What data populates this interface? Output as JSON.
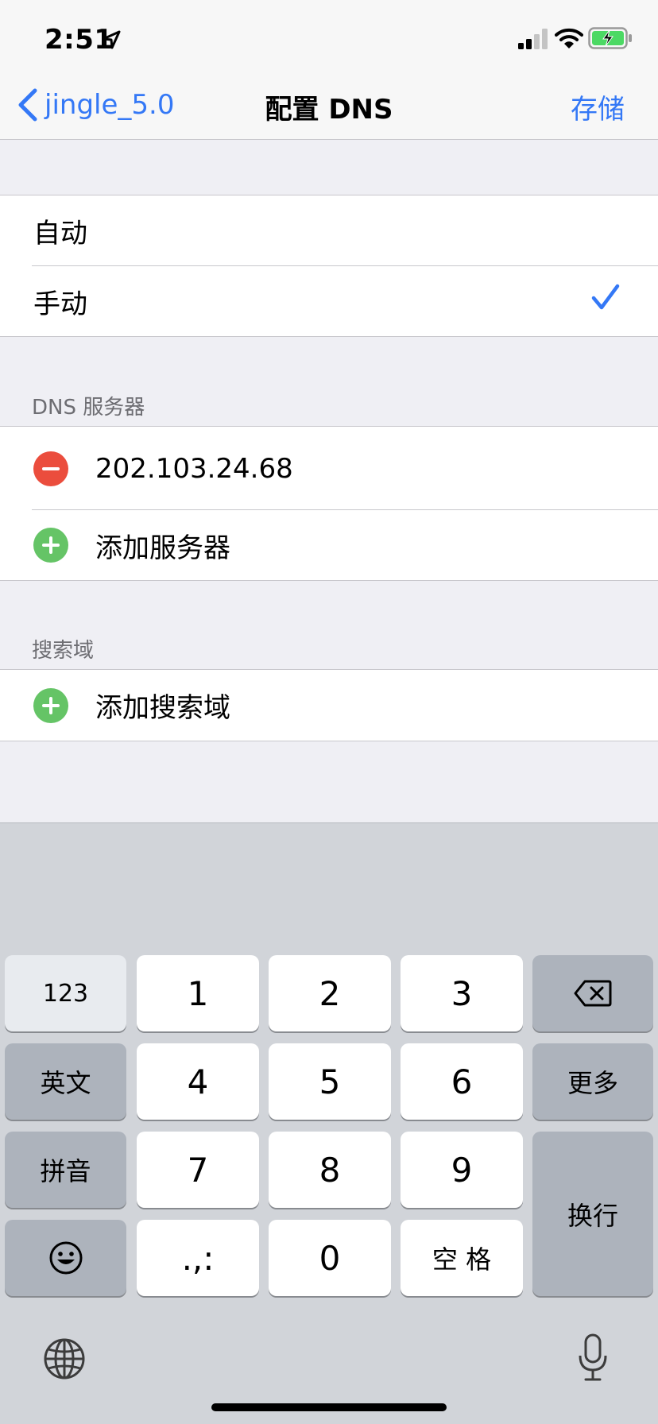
{
  "status_bar": {
    "time": "2:51"
  },
  "nav": {
    "back_label": "jingle_5.0",
    "title": "配置 DNS",
    "save_label": "存储"
  },
  "configure": {
    "items": [
      {
        "label": "自动",
        "selected": false
      },
      {
        "label": "手动",
        "selected": true
      }
    ]
  },
  "dns_servers": {
    "header": "DNS 服务器",
    "servers": [
      "202.103.24.68"
    ],
    "add_label": "添加服务器"
  },
  "search_domains": {
    "header": "搜索域",
    "add_label": "添加搜索域"
  },
  "keyboard": {
    "rows": [
      [
        "123",
        "1",
        "2",
        "3",
        "delete-icon"
      ],
      [
        "英文",
        "4",
        "5",
        "6",
        "更多"
      ],
      [
        "拼音",
        "7",
        "8",
        "9",
        "换行"
      ],
      [
        "emoji-icon",
        ".,:",
        "0",
        "空格"
      ]
    ],
    "key_123": "123",
    "key_1": "1",
    "key_2": "2",
    "key_3": "3",
    "key_en": "英文",
    "key_4": "4",
    "key_5": "5",
    "key_6": "6",
    "key_more": "更多",
    "key_pinyin": "拼音",
    "key_7": "7",
    "key_8": "8",
    "key_9": "9",
    "key_return": "换行",
    "key_punct": ".,:",
    "key_0": "0",
    "key_space": "空 格"
  },
  "colors": {
    "accent": "#3478f6",
    "delete_red": "#eb4d3d",
    "add_green": "#65c466",
    "background": "#efeff4"
  }
}
